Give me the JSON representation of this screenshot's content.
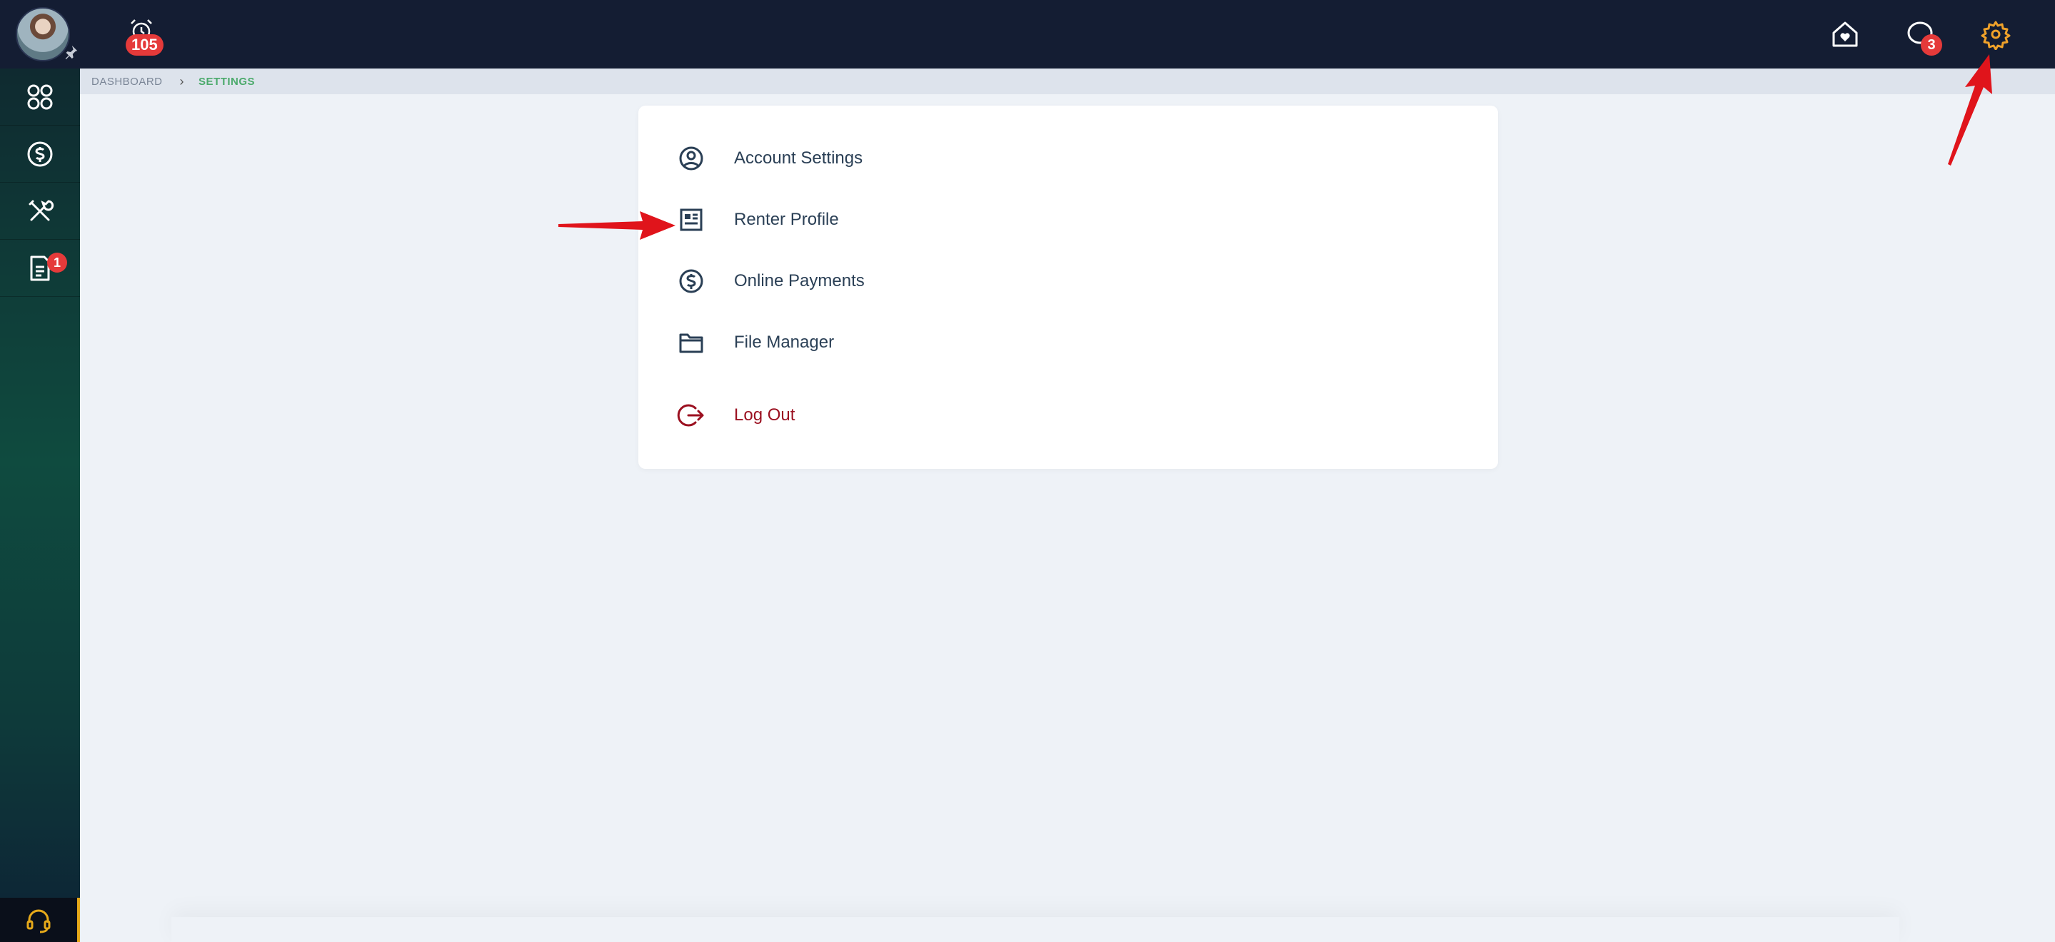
{
  "topbar": {
    "alarm_count": "105",
    "messages_count": "3",
    "colors": {
      "background": "#141d33",
      "badge": "#e53a3a",
      "active_settings": "#f0a22a"
    }
  },
  "sidebar": {
    "items": [
      {
        "icon": "dashboard-grid-icon"
      },
      {
        "icon": "dollar-circle-icon"
      },
      {
        "icon": "maintenance-tools-icon"
      },
      {
        "icon": "document-icon",
        "badge": "1"
      }
    ],
    "support_icon": "headset-icon"
  },
  "breadcrumb": {
    "items": [
      "DASHBOARD",
      "SETTINGS"
    ]
  },
  "settings_menu": {
    "items": [
      {
        "label": "Account Settings",
        "icon": "user-circle-icon"
      },
      {
        "label": "Renter Profile",
        "icon": "id-card-icon"
      },
      {
        "label": "Online Payments",
        "icon": "dollar-circle-icon"
      },
      {
        "label": "File Manager",
        "icon": "folder-icon"
      },
      {
        "label": "Log Out",
        "icon": "logout-icon"
      }
    ]
  }
}
